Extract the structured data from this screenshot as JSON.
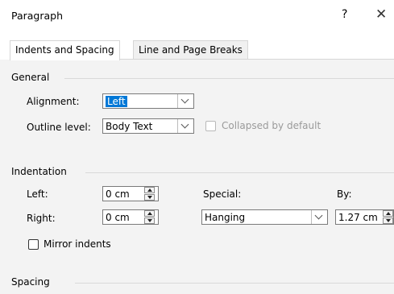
{
  "dialog": {
    "title": "Paragraph",
    "help": "?",
    "close": "✕"
  },
  "tabs": [
    {
      "label": "Indents and Spacing",
      "active": true
    },
    {
      "label": "Line and Page Breaks",
      "active": false
    }
  ],
  "general": {
    "heading": "General",
    "alignment_label": "Alignment:",
    "alignment_value": "Left",
    "outline_label": "Outline level:",
    "outline_value": "Body Text",
    "collapsed_label": "Collapsed by default"
  },
  "indentation": {
    "heading": "Indentation",
    "left_label": "Left:",
    "left_value": "0 cm",
    "right_label": "Right:",
    "right_value": "0 cm",
    "special_label": "Special:",
    "special_value": "Hanging",
    "by_label": "By:",
    "by_value": "1.27 cm",
    "mirror_label": "Mirror indents"
  },
  "spacing": {
    "heading": "Spacing"
  },
  "colors": {
    "selection": "#0078d7",
    "panel": "#f3f3f3"
  }
}
